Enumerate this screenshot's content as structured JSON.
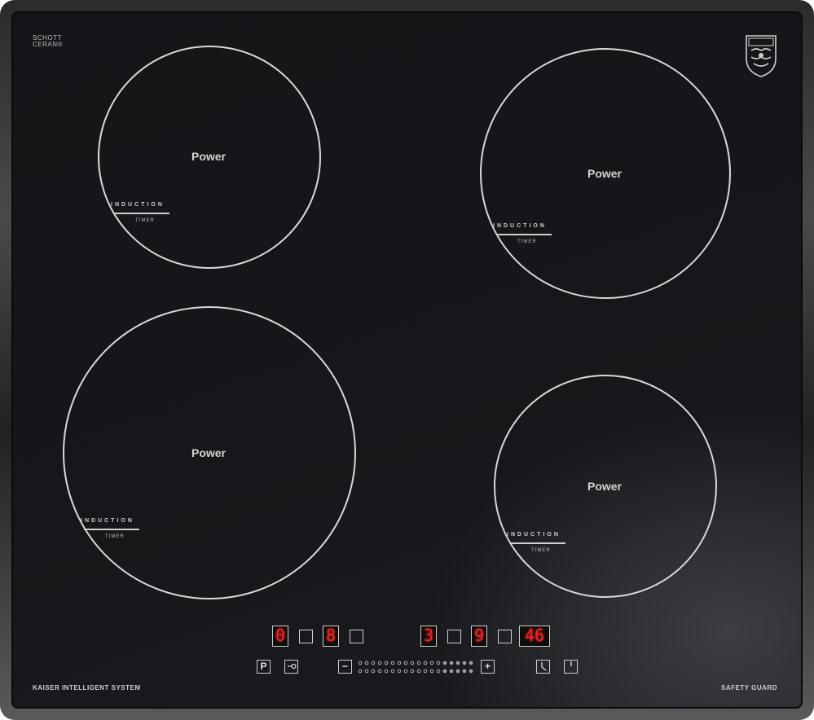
{
  "brand": {
    "schott_line1": "SCHOTT",
    "schott_line2": "CERAN®",
    "logo_text": "Kaiser",
    "system_label": "KAISER INTELLIGENT SYSTEM",
    "safety_label": "SAFETY GUARD"
  },
  "burners": [
    {
      "id": "rear-left",
      "power": "Power",
      "induction": "INDUCTION",
      "timer": "TIMER"
    },
    {
      "id": "rear-right",
      "power": "Power",
      "induction": "INDUCTION",
      "timer": "TIMER"
    },
    {
      "id": "front-left",
      "power": "Power",
      "induction": "INDUCTION",
      "timer": "TIMER"
    },
    {
      "id": "front-right",
      "power": "Power",
      "induction": "INDUCTION",
      "timer": "TIMER"
    }
  ],
  "display": {
    "zone1": "0",
    "zone2": "8",
    "zone3": "3",
    "zone4": "9",
    "timer": "46"
  },
  "controls": {
    "pause": "P",
    "lock": "⊸",
    "minus": "−",
    "plus": "+",
    "clock": "clock-icon",
    "power": "power-icon"
  },
  "colors": {
    "led": "#ff1f1f",
    "glass": "#16171a",
    "frame": "#4a4a4a"
  }
}
